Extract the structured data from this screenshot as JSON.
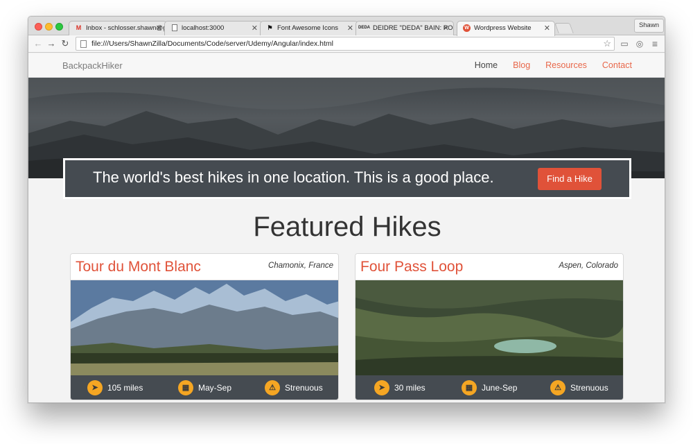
{
  "browser": {
    "tabs": [
      {
        "title": "Inbox - schlosser.shawn@g",
        "favicon": "gmail-icon",
        "active": false
      },
      {
        "title": "localhost:3000",
        "favicon": "page-icon",
        "active": false
      },
      {
        "title": "Font Awesome Icons",
        "favicon": "flag-icon",
        "active": false
      },
      {
        "title": "DEIDRE \"DEDA\" BAIN: POR",
        "favicon": "deda-icon",
        "active": false
      },
      {
        "title": "Wordpress Website",
        "favicon": "wordpress-icon",
        "active": true
      }
    ],
    "profile_name": "Shawn",
    "url": "file:///Users/ShawnZilla/Documents/Code/server/Udemy/Angular/index.html",
    "favicon_text": {
      "deda": "DEDA",
      "wp": "W"
    }
  },
  "site": {
    "brand": "BackpackHiker",
    "nav": [
      "Home",
      "Blog",
      "Resources",
      "Contact"
    ],
    "banner_text": "The world's best hikes in one location. This is a good place.",
    "cta_label": "Find a Hike",
    "section_title": "Featured Hikes",
    "hikes": [
      {
        "title": "Tour du Mont Blanc",
        "location": "Chamonix, France",
        "distance": "105 miles",
        "season": "May-Sep",
        "difficulty": "Strenuous"
      },
      {
        "title": "Four Pass Loop",
        "location": "Aspen, Colorado",
        "distance": "30 miles",
        "season": "June-Sep",
        "difficulty": "Strenuous"
      }
    ]
  },
  "colors": {
    "accent": "#e05239",
    "dark": "#454b51",
    "icon_bg": "#f5a623"
  }
}
